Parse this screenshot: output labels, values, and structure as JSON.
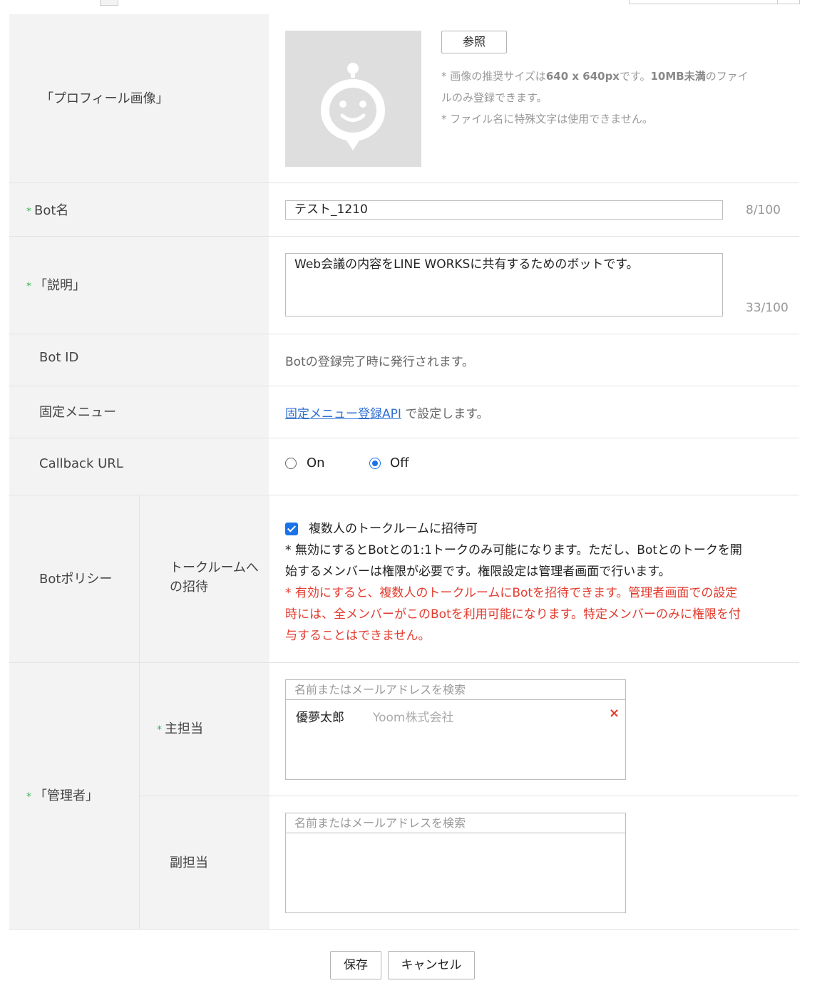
{
  "profile_image": {
    "label": "「プロフィール画像」",
    "browse_label": "参照",
    "note_line1_a": "* 画像の推奨サイズは",
    "note_line1_b": "640 x 640px",
    "note_line1_c": "です。",
    "note_line1_d": "10MB未満",
    "note_line1_e": "のファイ",
    "note_line2": "ルのみ登録できます。",
    "note_line3": "* ファイル名に特殊文字は使用できません。"
  },
  "bot_name": {
    "required_mark": "*",
    "label": "Bot名",
    "value": "テスト_1210",
    "counter": "8/100"
  },
  "description": {
    "required_mark": "*",
    "label": "「説明」",
    "value": "Web会議の内容をLINE WORKSに共有するためのボットです。",
    "counter": "33/100"
  },
  "bot_id": {
    "label": "Bot ID",
    "value": "Botの登録完了時に発行されます。"
  },
  "fixed_menu": {
    "label": "固定メニュー",
    "link_text": "固定メニュー登録API",
    "suffix": " で設定します。"
  },
  "callback_url": {
    "label": "Callback URL",
    "options": [
      "On",
      "Off"
    ],
    "selected": "Off"
  },
  "bot_policy": {
    "label": "Botポリシー",
    "sub_label_line1": "トークルームへ",
    "sub_label_line2": "の招待",
    "checkbox_label": "複数人のトークルームに招待可",
    "checked": true,
    "note_line1": "* 無効にするとBotとの1:1トークのみ可能になります。ただし、Botとのトークを開",
    "note_line2": "始するメンバーは権限が必要です。権限設定は管理者画面で行います。",
    "warn_line1": "* 有効にすると、複数人のトークルームにBotを招待できます。管理者画面での設定",
    "warn_line2": "時には、全メンバーがこのBotを利用可能になります。特定メンバーのみに権限を付",
    "warn_line3": "与することはできません。"
  },
  "admins": {
    "required_mark": "*",
    "label": "「管理者」",
    "primary": {
      "required_mark": "*",
      "label": "主担当",
      "search_placeholder": "名前またはメールアドレスを検索",
      "member_name": "優夢太郎",
      "member_org": "Yoom株式会社",
      "remove_icon": "×"
    },
    "secondary": {
      "label": "副担当",
      "search_placeholder": "名前またはメールアドレスを検索"
    }
  },
  "actions": {
    "save_label": "保存",
    "cancel_label": "キャンセル"
  },
  "colors": {
    "required": "#3ab552",
    "link": "#2f6fd1",
    "warning": "#e33b2e",
    "accent": "#1a73e8"
  }
}
